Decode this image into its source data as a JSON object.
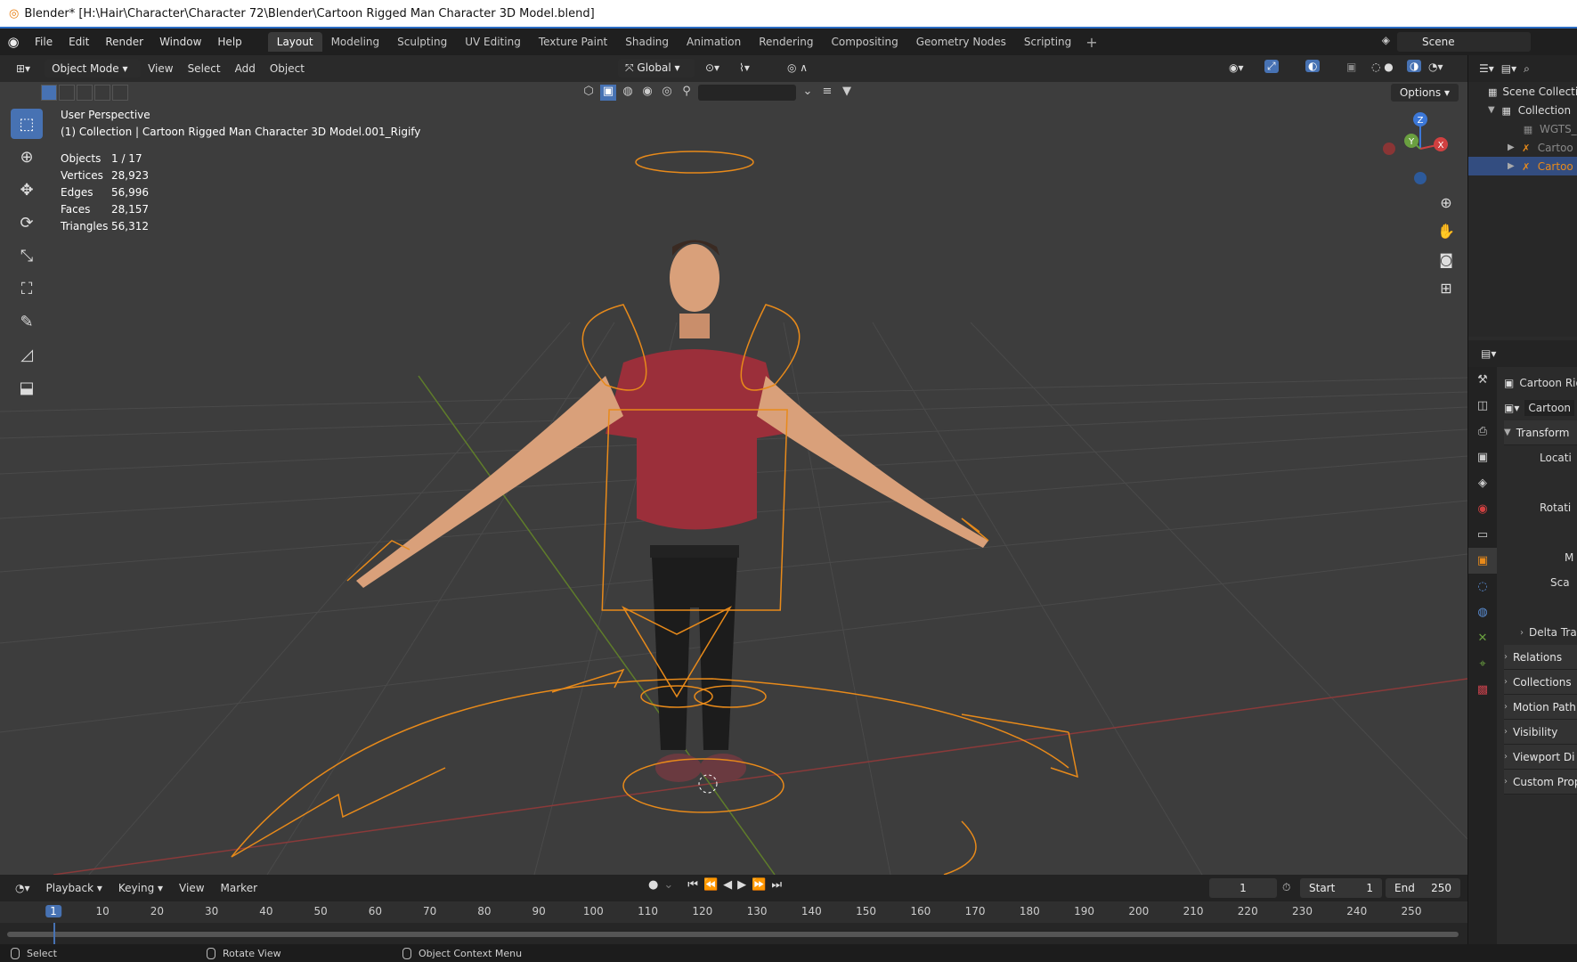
{
  "window": {
    "title": "Blender* [H:\\Hair\\Character\\Character 72\\Blender\\Cartoon Rigged Man Character 3D Model.blend]"
  },
  "menu": {
    "items": [
      "File",
      "Edit",
      "Render",
      "Window",
      "Help"
    ]
  },
  "workspaces": [
    "Layout",
    "Modeling",
    "Sculpting",
    "UV Editing",
    "Texture Paint",
    "Shading",
    "Animation",
    "Rendering",
    "Compositing",
    "Geometry Nodes",
    "Scripting"
  ],
  "active_workspace": "Layout",
  "scene": {
    "name": "Scene"
  },
  "viewport": {
    "mode": "Object Mode",
    "menus": [
      "View",
      "Select",
      "Add",
      "Object"
    ],
    "orientation": "Global",
    "options_label": "Options",
    "perspective": "User Perspective",
    "collection_info": "(1) Collection | Cartoon Rigged Man Character 3D Model.001_Rigify",
    "stats": [
      {
        "label": "Objects",
        "value": "1 / 17"
      },
      {
        "label": "Vertices",
        "value": "28,923"
      },
      {
        "label": "Edges",
        "value": "56,996"
      },
      {
        "label": "Faces",
        "value": "28,157"
      },
      {
        "label": "Triangles",
        "value": "56,312"
      }
    ],
    "gizmo_axes": [
      "Z",
      "Y",
      "X"
    ]
  },
  "timeline": {
    "menus": [
      "Playback",
      "Keying",
      "View",
      "Marker"
    ],
    "current_frame": "1",
    "start_label": "Start",
    "start": "1",
    "end_label": "End",
    "end": "250",
    "ticks": [
      "1",
      "10",
      "20",
      "30",
      "40",
      "50",
      "60",
      "70",
      "80",
      "90",
      "100",
      "110",
      "120",
      "130",
      "140",
      "150",
      "160",
      "170",
      "180",
      "190",
      "200",
      "210",
      "220",
      "230",
      "240",
      "250"
    ]
  },
  "statusbar": {
    "items": [
      "Select",
      "Rotate View",
      "Object Context Menu"
    ]
  },
  "outliner": {
    "rows": [
      "Scene Collecti",
      "Collection",
      "WGTS_",
      "Cartoo",
      "Cartoo"
    ]
  },
  "properties": {
    "object_name": "Cartoon Rig",
    "data_name": "Cartoon",
    "transform": "Transform",
    "location": "Locati",
    "rotation": "Rotati",
    "mode_short": "M",
    "scale": "Sca",
    "delta": "Delta Tra",
    "panels": [
      "Relations",
      "Collections",
      "Motion Path",
      "Visibility",
      "Viewport Di",
      "Custom Prop"
    ]
  },
  "colors": {
    "accent": "#4772b3",
    "rig": "#e88a1a",
    "selected_row": "#334d80"
  }
}
